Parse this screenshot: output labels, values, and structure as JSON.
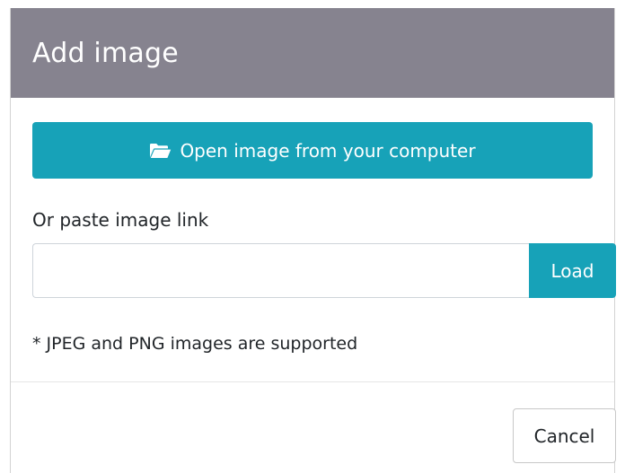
{
  "dialog": {
    "title": "Add image",
    "open_button_label": "Open image from your computer",
    "open_button_icon": "folder-open-icon",
    "paste_label": "Or paste image link",
    "url_input_value": "",
    "url_input_placeholder": "",
    "load_button_label": "Load",
    "support_note": "* JPEG and PNG images are supported",
    "cancel_button_label": "Cancel"
  },
  "colors": {
    "header_bg": "#86838f",
    "accent": "#17a2b8",
    "text": "#212529",
    "border": "#ced4da"
  }
}
